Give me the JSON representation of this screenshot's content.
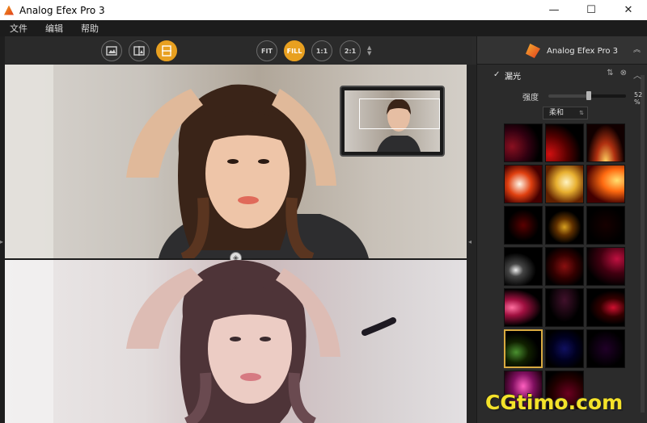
{
  "window": {
    "title": "Analog Efex Pro 3",
    "minimize_icon": "minimize-icon",
    "maximize_icon": "maximize-icon",
    "close_icon": "close-icon",
    "minimize_glyph": "—",
    "maximize_glyph": "☐",
    "close_glyph": "✕"
  },
  "menu": {
    "items": [
      "文件",
      "编辑",
      "帮助"
    ]
  },
  "toolbar": {
    "view_buttons": [
      {
        "icon": "single-view-icon"
      },
      {
        "icon": "split-view-icon"
      },
      {
        "icon": "side-by-side-view-icon",
        "active": true
      }
    ],
    "zoom_buttons": [
      {
        "label": "FIT",
        "active": false
      },
      {
        "label": "FILL",
        "active": true
      },
      {
        "label": "1:1",
        "active": false
      },
      {
        "label": "2:1",
        "active": false
      }
    ],
    "zoom_arrows": "▲\n▼"
  },
  "panel": {
    "title": "Analog Efex Pro 3",
    "collapse_glyph": "︽",
    "filter": {
      "checked": true,
      "check_glyph": "✓",
      "name": "漏光",
      "controls": [
        "⇅",
        "⊗",
        "︿"
      ]
    },
    "strength": {
      "label": "强度",
      "value": 0.52,
      "value_text": "52 %"
    },
    "blend_mode": {
      "selected": "柔和",
      "caret": "⇅"
    },
    "presets_selected_index": 15
  },
  "split_handle_glyph": "◈",
  "watermark": "CGtimo.com",
  "colors": {
    "accent": "#e8a020",
    "watermark": "#f4e22a"
  }
}
